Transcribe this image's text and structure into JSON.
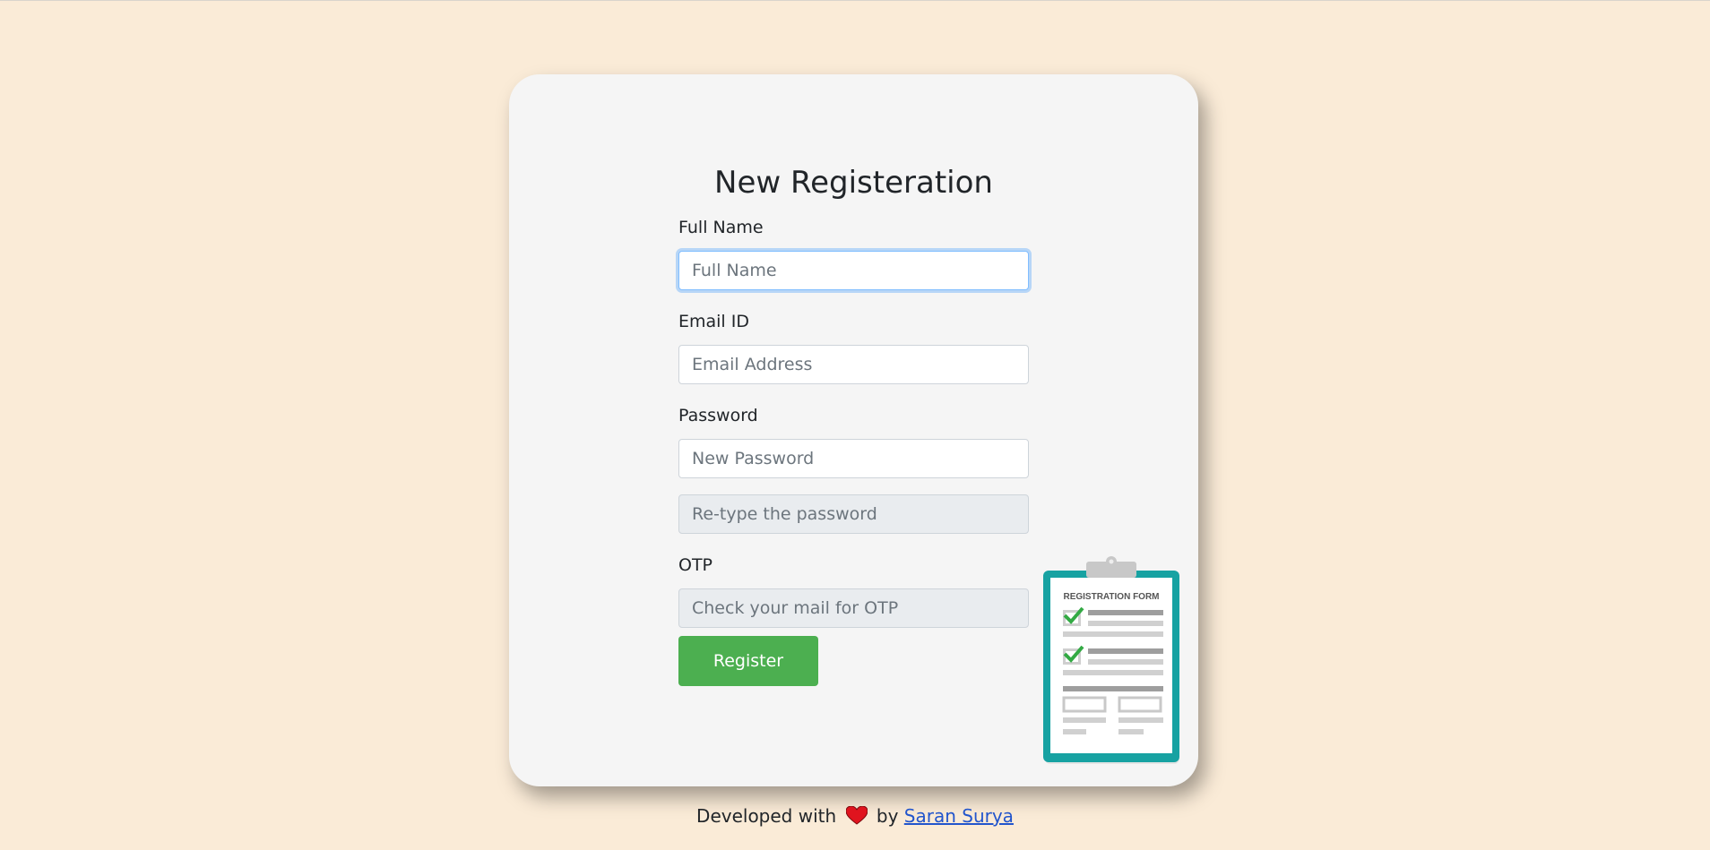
{
  "form": {
    "title": "New Registeration",
    "full_name_label": "Full Name",
    "full_name_placeholder": "Full Name",
    "email_label": "Email ID",
    "email_placeholder": "Email Address",
    "password_label": "Password",
    "password_placeholder": "New Password",
    "retype_placeholder": "Re-type the password",
    "otp_label": "OTP",
    "otp_placeholder": "Check your mail for OTP",
    "register_label": "Register"
  },
  "illustration": {
    "text": "REGISTRATION FORM",
    "icon": "clipboard-icon"
  },
  "footer": {
    "prefix": "Developed with",
    "middle": "by",
    "author_link": "Saran Surya",
    "heart_icon": "heart-icon"
  },
  "colors": {
    "background": "#faebd7",
    "card": "#f5f5f5",
    "button": "#4caf50",
    "clipboard": "#17a2a2",
    "link": "#2255cc"
  }
}
